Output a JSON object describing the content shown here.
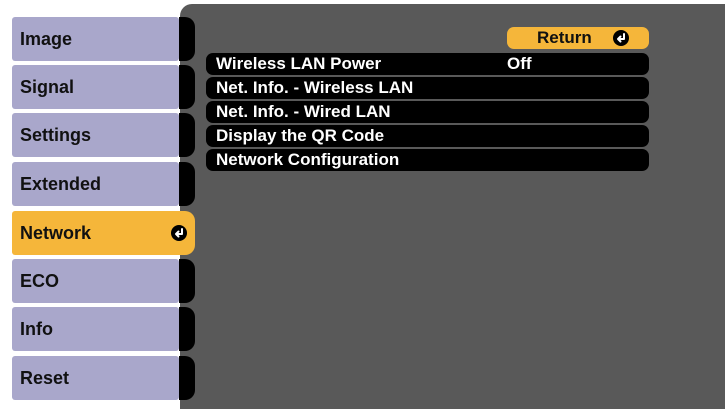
{
  "sidebar": {
    "items": [
      {
        "label": "Image"
      },
      {
        "label": "Signal"
      },
      {
        "label": "Settings"
      },
      {
        "label": "Extended"
      },
      {
        "label": "Network"
      },
      {
        "label": "ECO"
      },
      {
        "label": "Info"
      },
      {
        "label": "Reset"
      }
    ],
    "active_index": 4
  },
  "main": {
    "return_label": "Return",
    "rows": [
      {
        "label": "Wireless LAN Power",
        "value": "Off"
      },
      {
        "label": "Net. Info. - Wireless LAN",
        "value": ""
      },
      {
        "label": "Net. Info. - Wired LAN",
        "value": ""
      },
      {
        "label": "Display the QR Code",
        "value": ""
      },
      {
        "label": "Network Configuration",
        "value": ""
      }
    ]
  },
  "colors": {
    "panel_background": "#595959",
    "sidebar_item": "#a9a7cb",
    "highlight": "#f5b63a",
    "row_background": "#000000",
    "row_text": "#ffffff"
  },
  "icons": {
    "enter": "enter-icon"
  }
}
